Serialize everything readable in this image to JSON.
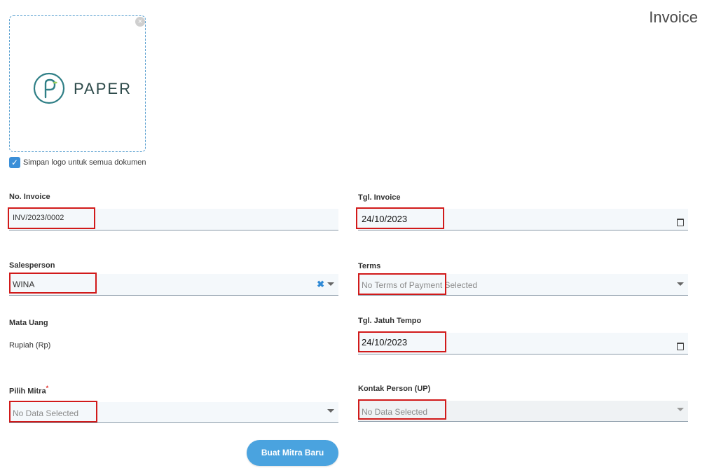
{
  "page": {
    "title": "Invoice"
  },
  "logo": {
    "brand_text": "PAPER",
    "remove_symbol": "×",
    "icon": "paper-logo-icon"
  },
  "save_logo": {
    "checked": true,
    "label": "Simpan logo untuk semua dokumen"
  },
  "form": {
    "invoice_no": {
      "label": "No. Invoice",
      "value": "INV/2023/0002"
    },
    "invoice_date": {
      "label": "Tgl. Invoice",
      "value": "24/10/2023"
    },
    "salesperson": {
      "label": "Salesperson",
      "value": "WINA",
      "clear_symbol": "✖"
    },
    "terms": {
      "label": "Terms",
      "placeholder": "No Terms of Payment Selected"
    },
    "currency": {
      "label": "Mata Uang",
      "value": "Rupiah (Rp)"
    },
    "due_date": {
      "label": "Tgl. Jatuh Tempo",
      "value": "24/10/2023"
    },
    "partner": {
      "label": "Pilih Mitra",
      "required_mark": "*",
      "placeholder": "No Data Selected"
    },
    "contact": {
      "label": "Kontak Person (UP)",
      "placeholder": "No Data Selected"
    }
  },
  "actions": {
    "create_partner": "Buat Mitra Baru"
  },
  "colors": {
    "accent": "#4aa3df",
    "highlight": "#d11a1a",
    "required": "#e53935"
  }
}
